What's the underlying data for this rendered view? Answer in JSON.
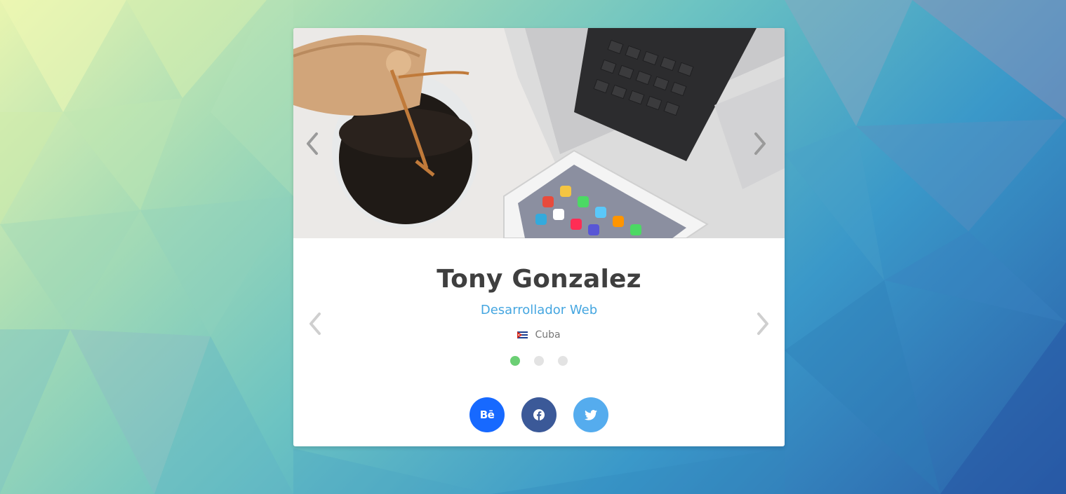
{
  "profile": {
    "name": "Tony Gonzalez",
    "role": "Desarrollador Web",
    "country": "Cuba"
  },
  "carousel": {
    "slide_count": 3,
    "active_index": 0,
    "active_color": "#6bcf74",
    "inactive_color": "#e3e3e3"
  },
  "social": {
    "behance_label": "Bē",
    "behance_color": "#1769ff",
    "facebook_color": "#3b5998",
    "twitter_color": "#55acee"
  },
  "colors": {
    "name": "#3f3f3f",
    "role": "#45a6e0",
    "country": "#777777",
    "arrow": "#c8c8c8"
  },
  "icons": {
    "hero_prev": "chevron-left-icon",
    "hero_next": "chevron-right-icon",
    "profile_prev": "chevron-left-icon",
    "profile_next": "chevron-right-icon",
    "flag": "cuba-flag-icon",
    "facebook": "facebook-icon",
    "twitter": "twitter-icon"
  }
}
